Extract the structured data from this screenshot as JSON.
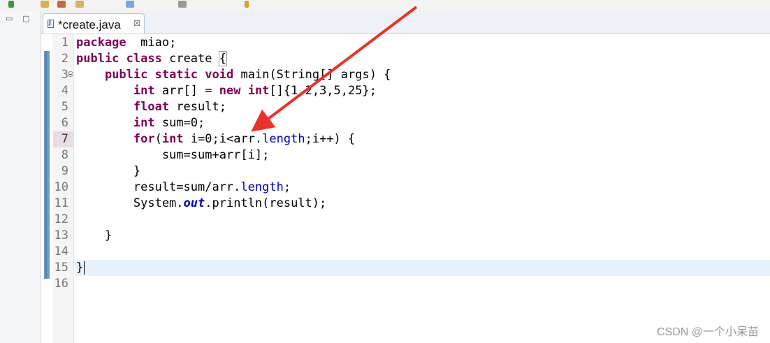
{
  "editor": {
    "tab": {
      "label": "*create.java",
      "close_glyph": "☒"
    },
    "lines": [
      {
        "n": "1",
        "tokens": [
          [
            "kw",
            "package"
          ],
          [
            "",
            "  miao;"
          ]
        ]
      },
      {
        "n": "2",
        "tokens": [
          [
            "kw",
            "public"
          ],
          [
            "",
            " "
          ],
          [
            "kw",
            "class"
          ],
          [
            "",
            " create "
          ],
          [
            "brace",
            "{"
          ]
        ]
      },
      {
        "n": "3",
        "tokens": [
          [
            "",
            "    "
          ],
          [
            "kw",
            "public"
          ],
          [
            "",
            " "
          ],
          [
            "kw",
            "static"
          ],
          [
            "",
            " "
          ],
          [
            "kw",
            "void"
          ],
          [
            "",
            " main(String[] args) {"
          ]
        ]
      },
      {
        "n": "4",
        "tokens": [
          [
            "",
            "        "
          ],
          [
            "kw",
            "int"
          ],
          [
            "",
            " arr[] = "
          ],
          [
            "kw",
            "new"
          ],
          [
            "",
            " "
          ],
          [
            "kw",
            "int"
          ],
          [
            "",
            "[]{1,2,3,5,25};"
          ]
        ]
      },
      {
        "n": "5",
        "tokens": [
          [
            "",
            "        "
          ],
          [
            "kw",
            "float"
          ],
          [
            "",
            " result;"
          ]
        ]
      },
      {
        "n": "6",
        "tokens": [
          [
            "",
            "        "
          ],
          [
            "kw",
            "int"
          ],
          [
            "",
            " sum=0;"
          ]
        ]
      },
      {
        "n": "7",
        "tokens": [
          [
            "",
            "        "
          ],
          [
            "kw",
            "for"
          ],
          [
            "",
            "("
          ],
          [
            "kw",
            "int"
          ],
          [
            "",
            " i=0;i<arr."
          ],
          [
            "fld",
            "length"
          ],
          [
            "",
            ";i++) {"
          ]
        ]
      },
      {
        "n": "8",
        "tokens": [
          [
            "",
            "            sum=sum+arr[i];"
          ]
        ]
      },
      {
        "n": "9",
        "tokens": [
          [
            "",
            "        }"
          ]
        ]
      },
      {
        "n": "10",
        "tokens": [
          [
            "",
            "        result=sum/arr."
          ],
          [
            "fld",
            "length"
          ],
          [
            "",
            ";"
          ]
        ]
      },
      {
        "n": "11",
        "tokens": [
          [
            "",
            "        System."
          ],
          [
            "stat",
            "out"
          ],
          [
            "",
            ".println(result);"
          ]
        ]
      },
      {
        "n": "12",
        "tokens": []
      },
      {
        "n": "13",
        "tokens": [
          [
            "",
            "    }"
          ]
        ]
      },
      {
        "n": "14",
        "tokens": []
      },
      {
        "n": "15",
        "tokens": [
          [
            "",
            "}"
          ]
        ],
        "caret": true
      },
      {
        "n": "16",
        "tokens": []
      }
    ]
  },
  "colors": {
    "keyword": "#7f0055",
    "field": "#0000c0",
    "annotation_arrow": "#e8322a",
    "current_line": "#e8f2fe"
  },
  "icons": [
    "minimize-icon",
    "maximize-icon",
    "java-file-icon",
    "close-tab-icon",
    "fold-toggle-icon",
    "red-arrow-annotation"
  ],
  "watermark": "CSDN @一个小呆苗"
}
